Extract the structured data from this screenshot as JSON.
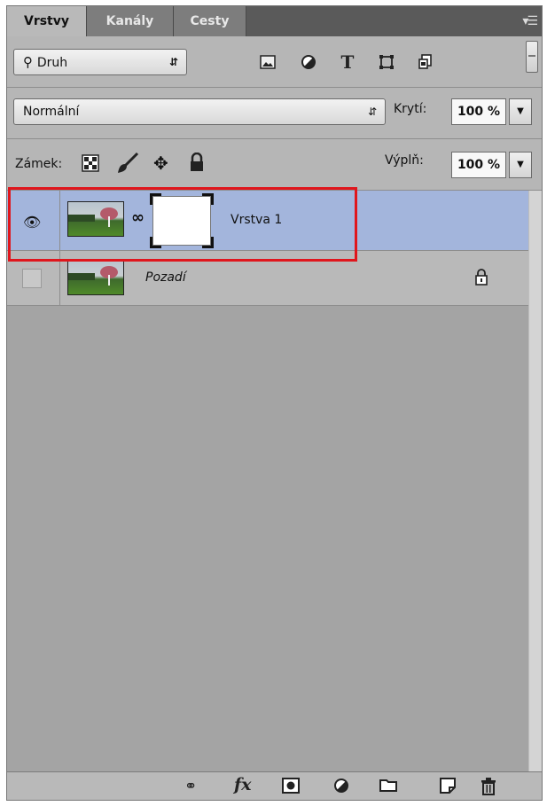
{
  "tabs": [
    {
      "label": "Vrstvy",
      "active": true
    },
    {
      "label": "Kanály",
      "active": false
    },
    {
      "label": "Cesty",
      "active": false
    }
  ],
  "filter": {
    "label": "Druh",
    "icons": [
      "image-filter-icon",
      "adjustment-filter-icon",
      "type-filter-icon",
      "shape-filter-icon",
      "smart-object-filter-icon"
    ]
  },
  "blend": {
    "mode": "Normální",
    "opacity_label": "Krytí:",
    "opacity_value": "100 %"
  },
  "lock": {
    "label": "Zámek:",
    "fill_label": "Výplň:",
    "fill_value": "100 %"
  },
  "layers": [
    {
      "name": "Vrstva 1",
      "selected": true,
      "visible": true,
      "has_mask": true
    },
    {
      "name": "Pozadí",
      "selected": false,
      "visible": false,
      "locked": true
    }
  ],
  "colors": {
    "panel_bg": "#a8a8a8",
    "selected_row": "#a3b5dc",
    "highlight_border": "#e0161c"
  }
}
